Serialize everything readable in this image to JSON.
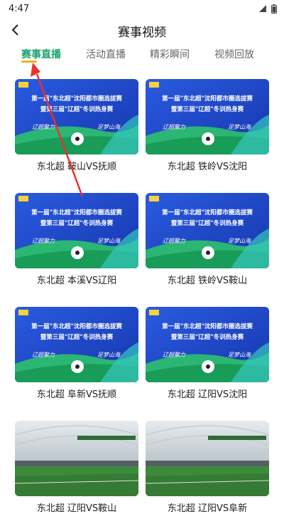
{
  "status": {
    "time": "4:47"
  },
  "header": {
    "title": "赛事视频"
  },
  "tabs": [
    {
      "label": "赛事直播",
      "active": true
    },
    {
      "label": "活动直播",
      "active": false
    },
    {
      "label": "精彩瞬间",
      "active": false
    },
    {
      "label": "视频回放",
      "active": false
    }
  ],
  "poster": {
    "line1": "第一届\"东北超\"沈阳都市圈选拔赛",
    "line2": "暨第三届\"辽超\"冬训热身赛",
    "slogan_left": "辽超聚力",
    "slogan_right": "足梦山海"
  },
  "videos": [
    {
      "title": "东北超 鞍山VS抚顺",
      "thumb": "poster"
    },
    {
      "title": "东北超 铁岭VS沈阳",
      "thumb": "poster"
    },
    {
      "title": "东北超 本溪VS辽阳",
      "thumb": "poster"
    },
    {
      "title": "东北超 铁岭VS鞍山",
      "thumb": "poster"
    },
    {
      "title": "东北超 阜新VS抚顺",
      "thumb": "poster"
    },
    {
      "title": "东北超 辽阳VS沈阳",
      "thumb": "poster"
    },
    {
      "title": "东北超 辽阳VS鞍山",
      "thumb": "stadium"
    },
    {
      "title": "东北超 辽阳VS阜新",
      "thumb": "stadium"
    }
  ],
  "colors": {
    "accent": "#1aa36e",
    "underline": "#f0b020",
    "poster_blue": "#1e47c9",
    "annotation_arrow": "#e8322b"
  }
}
